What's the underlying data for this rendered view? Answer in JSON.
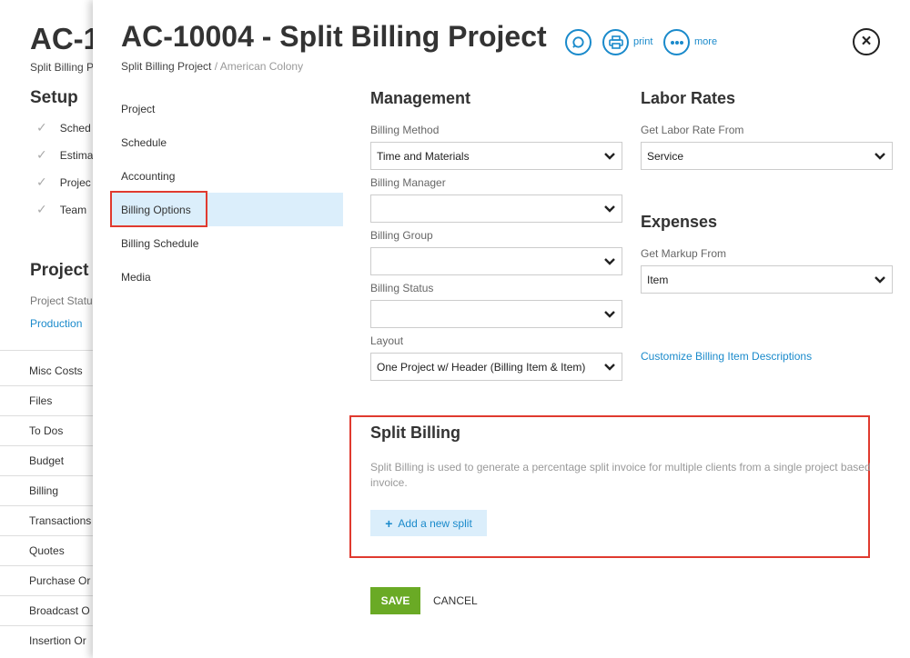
{
  "background": {
    "title": "AC-1",
    "subtitle": "Split Billing P",
    "setup_heading": "Setup",
    "setup_items": [
      "Sched",
      "Estima",
      "Projec",
      "Team"
    ],
    "project_heading": "Project I",
    "project_status_label": "Project Statu",
    "project_status_value": "Production",
    "nav_items": [
      "Misc Costs",
      "Files",
      "To Dos",
      "Budget",
      "Billing",
      "Transactions",
      "Quotes",
      "Purchase Or",
      "Broadcast O",
      "Insertion Or"
    ]
  },
  "modal": {
    "title": "AC-10004 - Split Billing Project",
    "breadcrumb_current": "Split Billing Project",
    "breadcrumb_separator": "/",
    "breadcrumb_parent": "American Colony",
    "print_label": "print",
    "more_label": "more",
    "close_icon": "×",
    "nav": [
      "Project",
      "Schedule",
      "Accounting",
      "Billing Options",
      "Billing Schedule",
      "Media"
    ],
    "active_nav": "Billing Options"
  },
  "management": {
    "heading": "Management",
    "billing_method": {
      "label": "Billing Method",
      "value": "Time and Materials"
    },
    "billing_manager": {
      "label": "Billing Manager",
      "value": ""
    },
    "billing_group": {
      "label": "Billing Group",
      "value": ""
    },
    "billing_status": {
      "label": "Billing Status",
      "value": ""
    },
    "layout": {
      "label": "Layout",
      "value": "One Project w/ Header (Billing Item & Item)"
    }
  },
  "labor_rates": {
    "heading": "Labor Rates",
    "label": "Get Labor Rate From",
    "value": "Service"
  },
  "expenses": {
    "heading": "Expenses",
    "label": "Get Markup From",
    "value": "Item"
  },
  "customize_link": "Customize Billing Item Descriptions",
  "split_billing": {
    "heading": "Split Billing",
    "description": "Split Billing is used to generate a percentage split invoice for multiple clients from a single project based invoice.",
    "add_icon": "+",
    "add_label": "Add a new split"
  },
  "actions": {
    "save": "SAVE",
    "cancel": "CANCEL"
  },
  "colors": {
    "accent": "#1a8acb",
    "save": "#6aaa25",
    "highlight": "#e03a2f",
    "active_bg": "#dbeefb"
  }
}
